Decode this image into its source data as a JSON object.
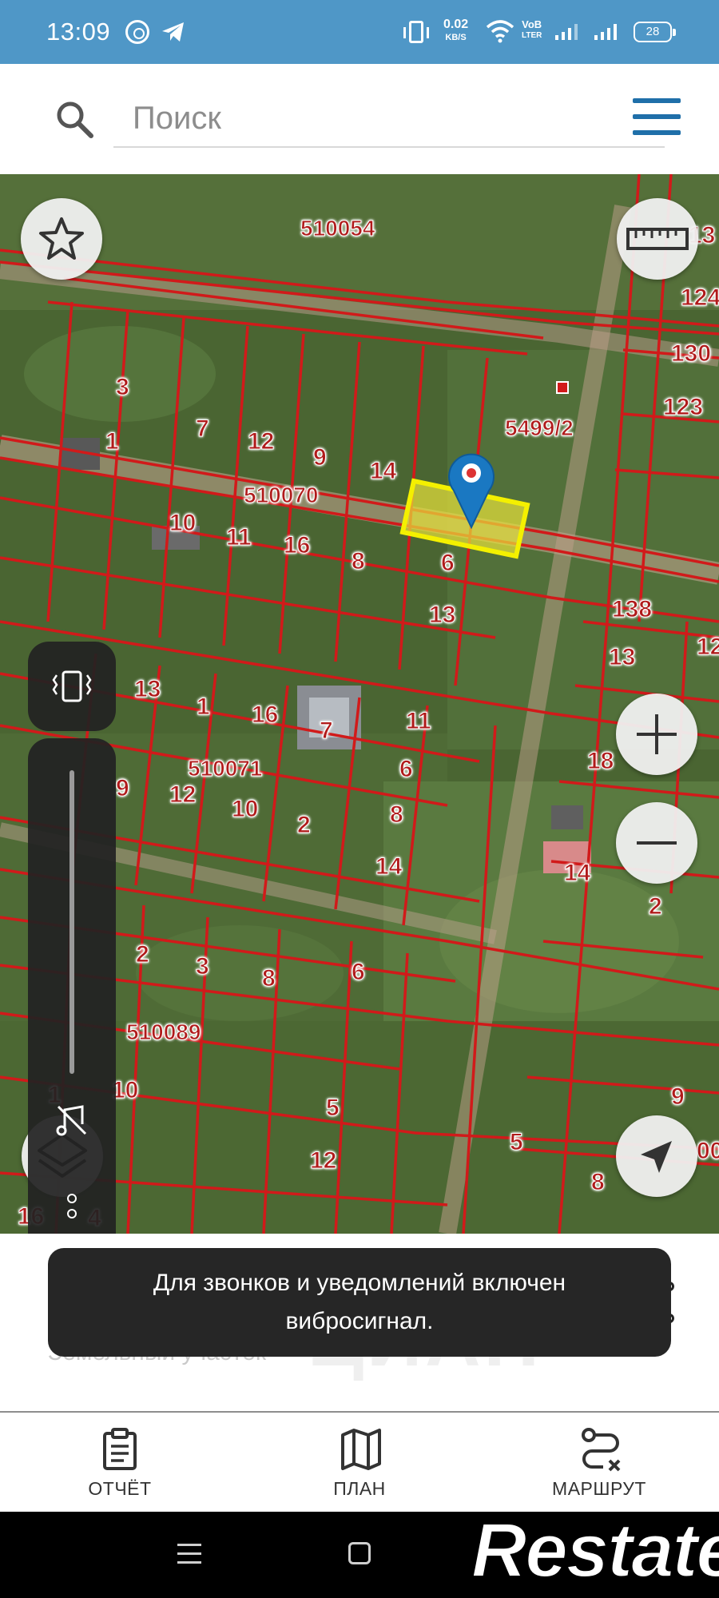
{
  "status_bar": {
    "time": "13:09",
    "net_speed_value": "0.02",
    "net_speed_unit": "KB/S",
    "volte_top": "VoB",
    "volte_bottom": "LTER",
    "battery": "28",
    "icons": [
      "whatsapp-icon",
      "telegram-icon",
      "vibrate-icon",
      "wifi-icon",
      "signal-icon",
      "signal-icon",
      "battery-icon"
    ]
  },
  "search": {
    "placeholder": "Поиск"
  },
  "map": {
    "block_labels": [
      "510054",
      "510070",
      "510071",
      "510089",
      "5499/2"
    ],
    "plot_numbers": [
      "3",
      "7",
      "1",
      "12",
      "9",
      "14",
      "10",
      "11",
      "16",
      "8",
      "6",
      "13",
      "13",
      "1",
      "16",
      "7",
      "11",
      "6",
      "9",
      "12",
      "10",
      "2",
      "8",
      "14",
      "2",
      "3",
      "8",
      "6",
      "5",
      "12",
      "10",
      "1",
      "16",
      "4",
      "13",
      "124",
      "130",
      "123",
      "138",
      "13",
      "12",
      "18",
      "14",
      "2",
      "9",
      "5",
      "8",
      "00"
    ],
    "colors": {
      "boundary": "#d11a1a",
      "road": "#e9a9a0",
      "selected_fill": "#e8e23a",
      "selected_border": "#f4f000",
      "pin": "#1a78c2"
    }
  },
  "side_panel": {
    "icons": [
      "vibrate-icon",
      "mute-icon",
      "more-icon"
    ]
  },
  "toast": {
    "line1": "Для звонков и уведомлений включен",
    "line2": "вибросигнал."
  },
  "bottom_sheet": {
    "subtitle": "Земельный участок",
    "watermark": "ЦИАН"
  },
  "bottom_nav": {
    "items": [
      {
        "label": "ОТЧЁТ",
        "icon": "clipboard-icon"
      },
      {
        "label": "ПЛАН",
        "icon": "map-icon"
      },
      {
        "label": "МАРШРУТ",
        "icon": "route-icon"
      }
    ]
  },
  "logo": {
    "text": "Restate"
  }
}
